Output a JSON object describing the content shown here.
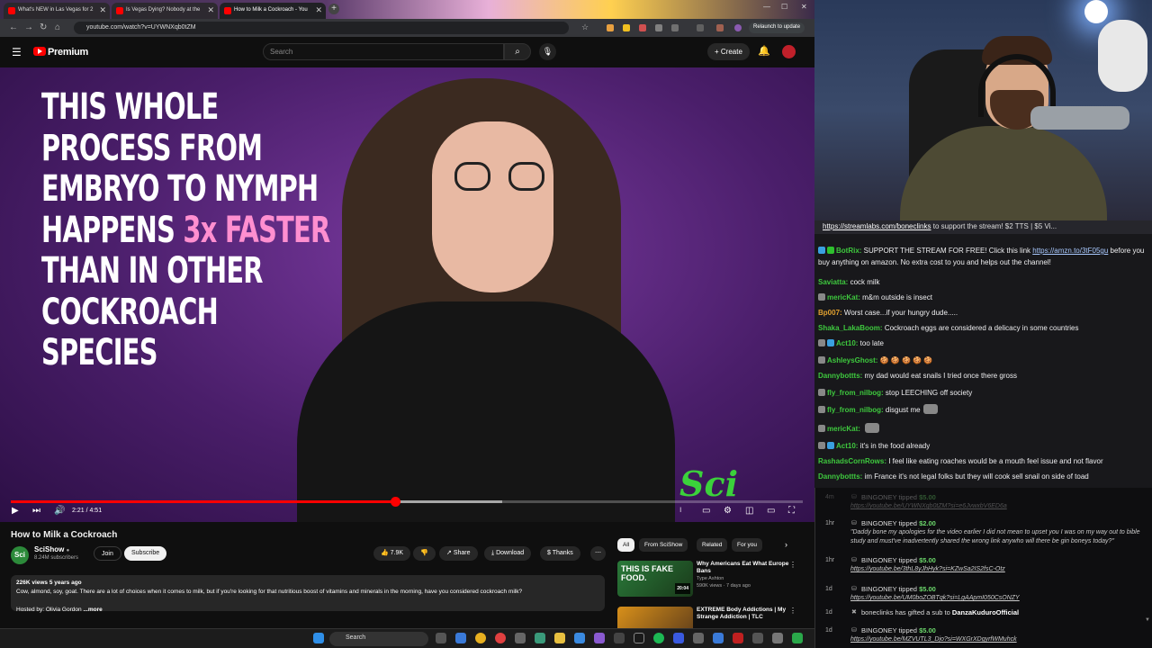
{
  "browser": {
    "tabs": [
      {
        "label": "What's NEW in Las Vegas for 2"
      },
      {
        "label": "Is Vegas Dying? Nobody at the"
      },
      {
        "label": "How to Milk a Cockroach - You"
      }
    ],
    "url": "youtube.com/watch?v=UYWNXqb0tZM",
    "relaunch_label": "Relaunch to update"
  },
  "youtube": {
    "brand": "Premium",
    "search_placeholder": "Search",
    "create_label": "Create"
  },
  "video": {
    "caption_lines": [
      "THIS WHOLE",
      "PROCESS FROM",
      "EMBRYO TO NYMPH"
    ],
    "caption_happens": "HAPPENS",
    "caption_highlight": "3x FASTER",
    "caption_lines_2": [
      "THAN IN OTHER",
      "COCKROACH",
      "SPECIES"
    ],
    "watermark": "Sci",
    "time": "2:21 / 4:51",
    "progress": 0.485,
    "buffered": 0.62
  },
  "details": {
    "title": "How to Milk a Cockroach",
    "channel": "SciShow",
    "channel_initials": "Sci",
    "subscribers": "8.24M subscribers",
    "join_label": "Join",
    "subscribe_label": "Subscribe",
    "likes": "7.9K",
    "share_label": "Share",
    "download_label": "Download",
    "thanks_label": "Thanks",
    "meta": "226K views  5 years ago",
    "description": "Cow, almond, soy, goat. There are a lot of choices when it comes to milk, but if you're looking for that nutritious boost of vitamins and minerals in the morning, have you considered cockroach milk?",
    "hosted_by": "Hosted by: Olivia Gordon",
    "more_label": "...more"
  },
  "chips": [
    "All",
    "From SciShow",
    "Related",
    "For you"
  ],
  "recommendations": [
    {
      "thumb_text": "THIS IS FAKE FOOD.",
      "duration": "20:04",
      "title": "Why Americans Eat What Europe Bans",
      "channel": "Type Ashton",
      "stats": "590K views · 7 days ago"
    },
    {
      "thumb_text": "",
      "duration": "",
      "title": "EXTREME Body Addictions | My Strange Addiction | TLC",
      "channel": "",
      "stats": ""
    }
  ],
  "taskbar": {
    "search_label": "Search"
  },
  "chat": {
    "banner_link": "https://streamlabs.com/boneclinks",
    "banner_text": " to support the stream! $2 TTS | $5 Vi...",
    "messages": [
      {
        "user": "BotRix:",
        "color": "#3ec93e",
        "text": " SUPPORT THE STREAM FOR FREE! Click this link ",
        "link": "https://amzn.to/3tF05gu",
        "text2": " before you buy anything on amazon. No extra cost to you and helps out the channel!"
      },
      {
        "user": "Saviatta:",
        "color": "#3ec93e",
        "text": " cock milk"
      },
      {
        "user": "mericKat:",
        "color": "#3ec93e",
        "text": " m&m outside is insect"
      },
      {
        "user": "Bp007:",
        "color": "#e0a030",
        "text": " Worst case...if your hungry dude....."
      },
      {
        "user": "Shaka_LakaBoom:",
        "color": "#3ec93e",
        "text": " Cockroach eggs are considered a delicacy in some countries"
      },
      {
        "user": "Act10:",
        "color": "#3ec93e",
        "text": " too late"
      },
      {
        "user": "AshleysGhost:",
        "color": "#3ec93e",
        "text": "  🍪 🍪 🍪 🍪 🍪"
      },
      {
        "user": "Dannybottts:",
        "color": "#3ec93e",
        "text": " my dad would eat snails I tried once there gross"
      },
      {
        "user": "fly_from_nilbog:",
        "color": "#3ec93e",
        "text": " stop LEECHING off society"
      },
      {
        "user": "fly_from_nilbog:",
        "color": "#3ec93e",
        "text": " disgust me"
      },
      {
        "user": "mericKat:",
        "color": "#3ec93e",
        "text": " "
      },
      {
        "user": "Act10:",
        "color": "#3ec93e",
        "text": " it's in the food already"
      },
      {
        "user": "RashadsCornRows:",
        "color": "#3ec93e",
        "text": " I feel like eating roaches would be a mouth feel issue and not flavor"
      },
      {
        "user": "Dannybottts:",
        "color": "#3ec93e",
        "text": " im France it's not legal folks but they will cook sell snail on side of toad"
      }
    ]
  },
  "tips": [
    {
      "age": "4m",
      "head": "BINGONEY tipped ",
      "amount": "$5.00",
      "body": "https://youtube.be/UYWNXqb0tZM?si=e6JvwxbV6ED6a",
      "link": true
    },
    {
      "age": "1hr",
      "head": "BINGONEY tipped ",
      "amount": "$2.00",
      "body": "\"Daddy bone my apologies for the video earlier I did not mean to upset you I was on my way out to bible study and must've inadvertently shared the wrong link anywho will there be gin boneys today?\"",
      "link": false
    },
    {
      "age": "1hr",
      "head": "BINGONEY tipped ",
      "amount": "$5.00",
      "body": "https://youtube.be/3thL8yJhHyk?si=KZwSa2IS2fsC-Otz",
      "link": true
    },
    {
      "age": "1d",
      "head": "BINGONEY tipped ",
      "amount": "$5.00",
      "body": "https://youtube.be/UM0boZOBTqk?si=LgAApmI050CsONZY",
      "link": true
    },
    {
      "age": "1d",
      "head": "boneclinks has gifted a sub to ",
      "amount": "DanzaKuduroOfficial",
      "body": "",
      "link": false
    },
    {
      "age": "1d",
      "head": "BINGONEY tipped ",
      "amount": "$5.00",
      "body": "https://youtube.be/MZVUTL3_Djo?si=WXGrXDgyrfWMuhck",
      "link": true
    }
  ]
}
